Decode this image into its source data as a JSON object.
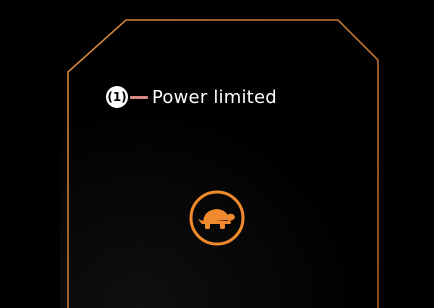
{
  "callout": {
    "number": "(1)",
    "label": "Power limited"
  },
  "indicator": {
    "icon": "turtle-icon",
    "color": "#f08a2c"
  },
  "colors": {
    "background": "#000000",
    "frame": "#c9772e",
    "leader_line": "#d98a86",
    "label_text": "#ffffff"
  }
}
